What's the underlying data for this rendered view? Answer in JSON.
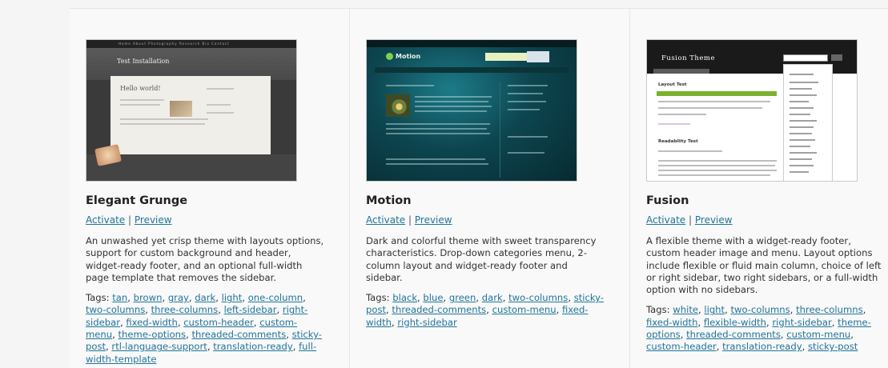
{
  "themes": [
    {
      "name": "Elegant Grunge",
      "activate": "Activate",
      "separator": "|",
      "preview": "Preview",
      "description": "An unwashed yet crisp theme with layouts options, support for custom background and header, widget-ready footer, and an optional full-width page template that removes the sidebar.",
      "tags_label": "Tags:",
      "tags": [
        "tan",
        "brown",
        "gray",
        "dark",
        "light",
        "one-column",
        "two-columns",
        "three-columns",
        "left-sidebar",
        "right-sidebar",
        "fixed-width",
        "custom-header",
        "custom-menu",
        "theme-options",
        "threaded-comments",
        "sticky-post",
        "rtl-language-support",
        "translation-ready",
        "full-width-template"
      ],
      "thumbnail": {
        "site_title": "Test Installation",
        "post_title": "Hello world!",
        "nav_text": "Home About Photography Research Bio Contact"
      }
    },
    {
      "name": "Motion",
      "activate": "Activate",
      "separator": "|",
      "preview": "Preview",
      "description": "Dark and colorful theme with sweet transparency characteristics. Drop-down categories menu, 2-column layout and widget-ready footer and sidebar.",
      "tags_label": "Tags:",
      "tags": [
        "black",
        "blue",
        "green",
        "dark",
        "two-columns",
        "sticky-post",
        "threaded-comments",
        "custom-menu",
        "fixed-width",
        "right-sidebar"
      ],
      "thumbnail": {
        "site_title": "Motion"
      }
    },
    {
      "name": "Fusion",
      "activate": "Activate",
      "separator": "|",
      "preview": "Preview",
      "description": "A flexible theme with a widget-ready footer, custom header image and menu. Layout options include flexible or fluid main column, choice of left or right sidebar, two right sidebars, or a full-width option with no sidebars.",
      "tags_label": "Tags:",
      "tags": [
        "white",
        "light",
        "two-columns",
        "three-columns",
        "fixed-width",
        "flexible-width",
        "right-sidebar",
        "theme-options",
        "threaded-comments",
        "custom-menu",
        "custom-header",
        "translation-ready",
        "sticky-post"
      ],
      "thumbnail": {
        "site_title": "Fusion Theme",
        "post_title_1": "Layout Test",
        "post_title_2": "Readability Test"
      }
    }
  ],
  "colors": {
    "link": "#21759b",
    "heading": "#222222",
    "background": "#f9f9f9"
  }
}
